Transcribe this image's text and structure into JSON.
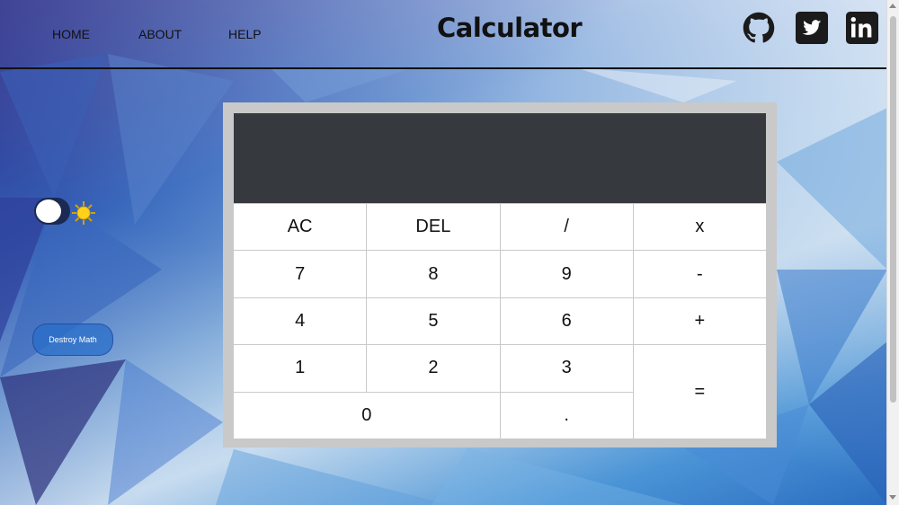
{
  "nav": {
    "links": [
      "HOME",
      "ABOUT",
      "HELP"
    ],
    "title": "Calculator",
    "social_icons": [
      "github-icon",
      "twitter-icon",
      "linkedin-icon"
    ]
  },
  "sidebar": {
    "theme_toggle_icon": "sun-icon",
    "destroy_label": "Destroy Math"
  },
  "calculator": {
    "display_value": "",
    "keys": [
      "AC",
      "DEL",
      "/",
      "x",
      "7",
      "8",
      "9",
      "-",
      "4",
      "5",
      "6",
      "+",
      "1",
      "2",
      "3",
      "=",
      "0",
      "."
    ]
  },
  "colors": {
    "display_bg": "#363a3f",
    "frame": "#c9c9c9"
  }
}
